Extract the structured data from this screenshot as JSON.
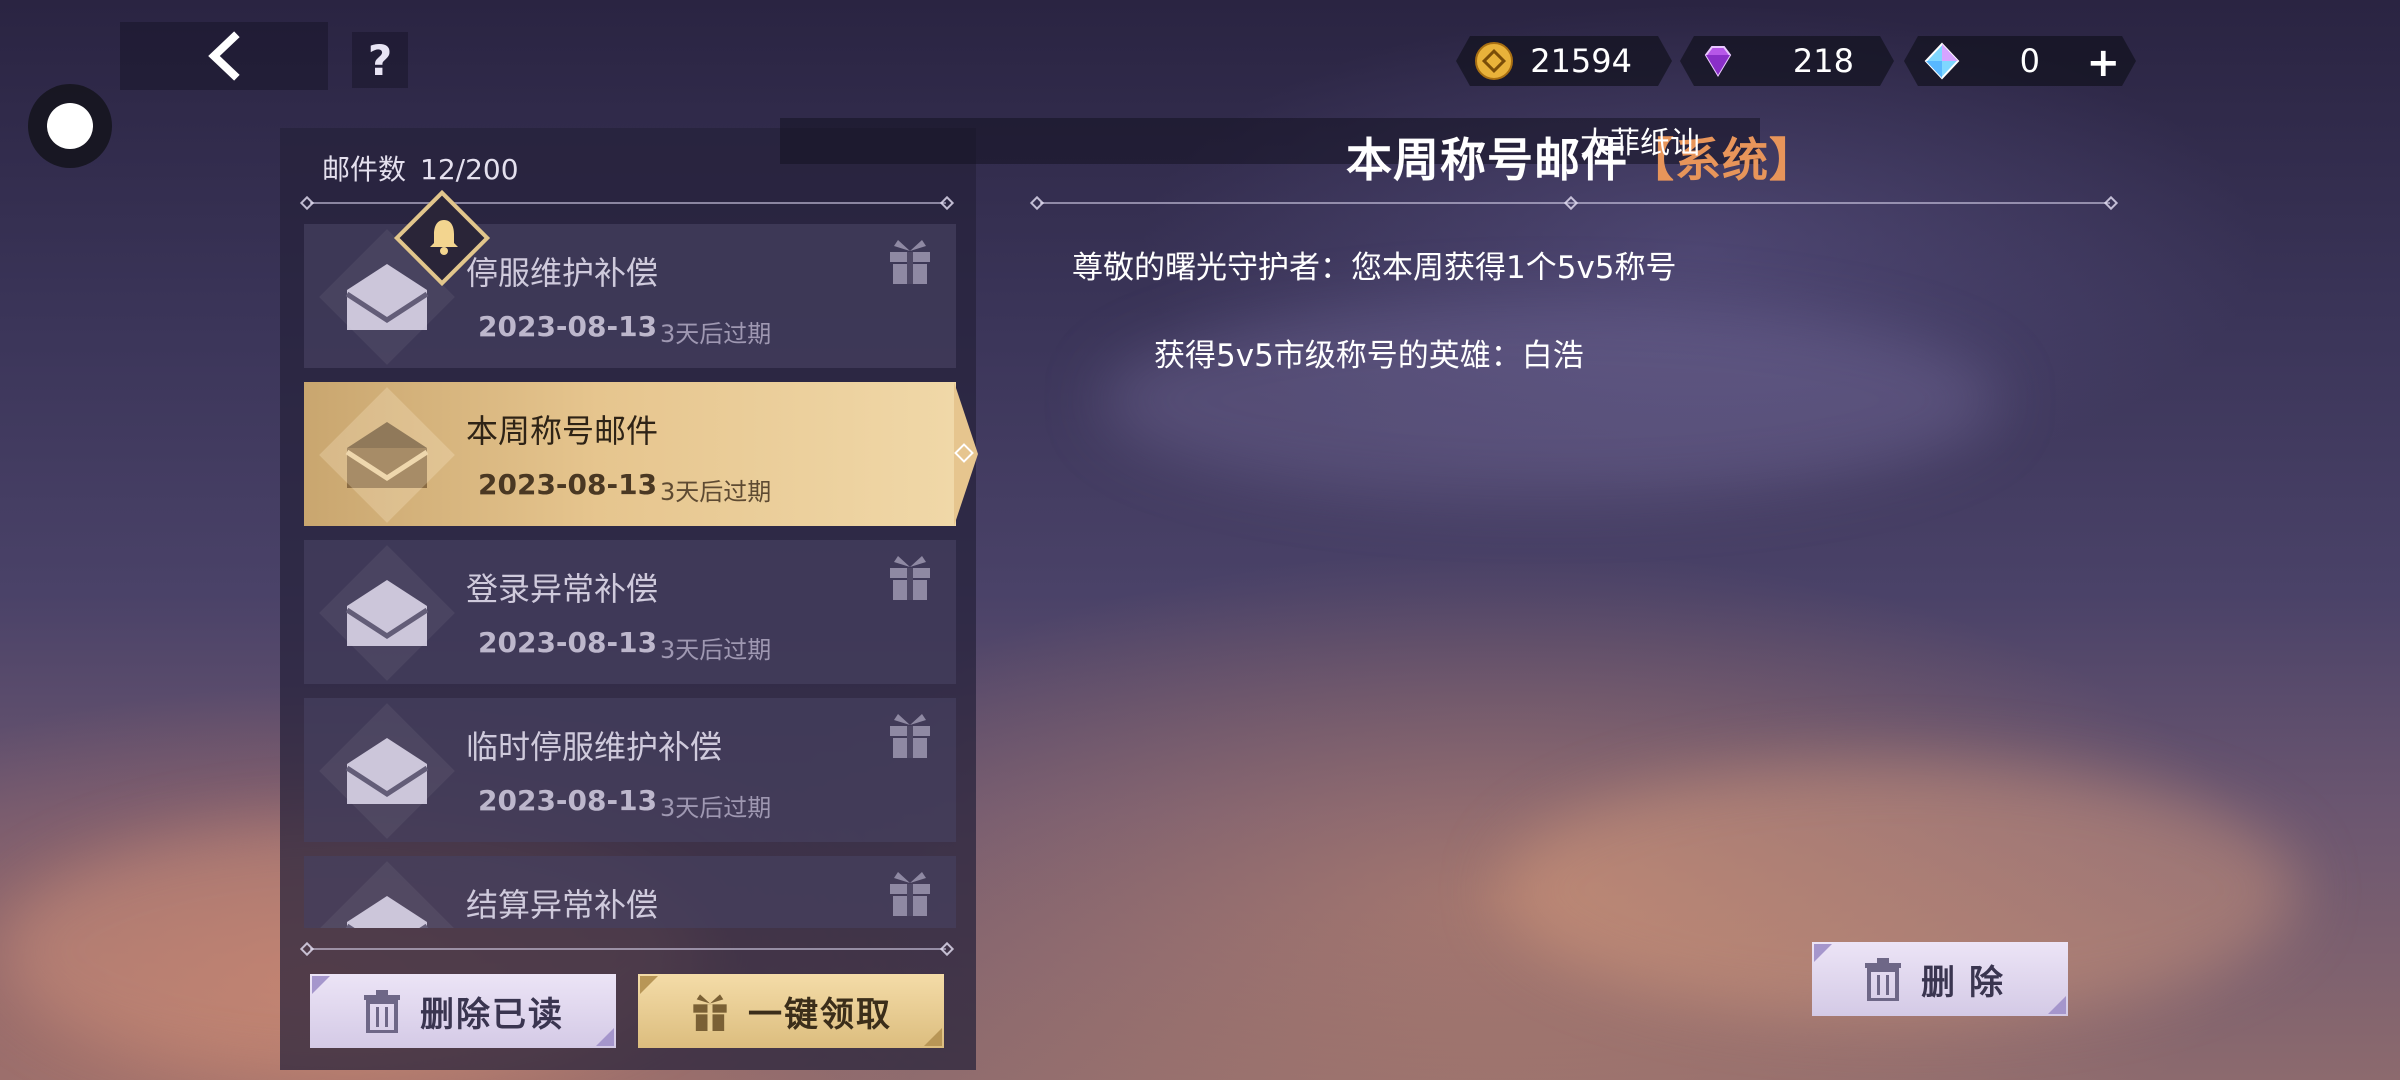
{
  "header": {
    "back_icon": "chevron-left-icon",
    "help_label": "?"
  },
  "currency": {
    "gold": "21594",
    "purple_diamond": "218",
    "crystal": "0",
    "add_label": "+"
  },
  "mail_list": {
    "count_label": "邮件数",
    "count_value": "12/200",
    "items": [
      {
        "title": "停服维护补偿",
        "date": "2023-08-13",
        "expires": "3天后过期",
        "has_gift": true
      },
      {
        "title": "本周称号邮件",
        "date": "2023-08-13",
        "expires": "3天后过期",
        "has_gift": false,
        "selected": true
      },
      {
        "title": "登录异常补偿",
        "date": "2023-08-13",
        "expires": "3天后过期",
        "has_gift": true
      },
      {
        "title": "临时停服维护补偿",
        "date": "2023-08-13",
        "expires": "3天后过期",
        "has_gift": true
      },
      {
        "title": "结算异常补偿",
        "date": "",
        "expires": "",
        "has_gift": true
      }
    ],
    "delete_read_label": "删除已读",
    "claim_all_label": "一键领取"
  },
  "detail": {
    "title": "本周称号邮件",
    "source": "【系统】",
    "overlay_text": "大菲纸讪",
    "line1": "尊敬的曙光守护者：您本周获得1个5v5称号",
    "line2": "获得5v5市级称号的英雄：白浩",
    "delete_label": "删除"
  }
}
